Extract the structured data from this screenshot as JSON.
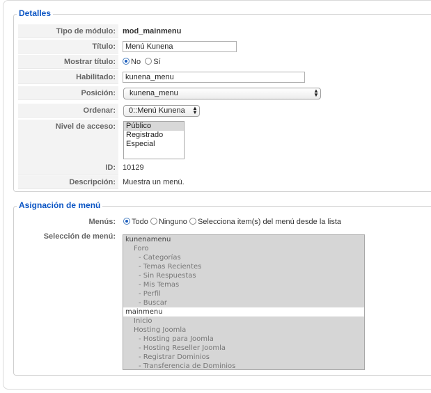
{
  "details": {
    "legend": "Detalles",
    "module_type": {
      "label": "Tipo de módulo:",
      "value": "mod_mainmenu"
    },
    "title": {
      "label": "Título:",
      "value": "Menú Kunena"
    },
    "show_title": {
      "label": "Mostrar título:",
      "options": [
        "No",
        "Sí"
      ],
      "selected": "No"
    },
    "enabled": {
      "label": "Habilitado:",
      "value": "kunena_menu"
    },
    "position": {
      "label": "Posición:",
      "value": "kunena_menu"
    },
    "order": {
      "label": "Ordenar:",
      "value": "0::Menú Kunena"
    },
    "access": {
      "label": "Nivel de acceso:",
      "options": [
        "Público",
        "Registrado",
        "Especial"
      ],
      "selected": "Público"
    },
    "id": {
      "label": "ID:",
      "value": "10129"
    },
    "description": {
      "label": "Descripción:",
      "value": "Muestra un menú."
    }
  },
  "menu_assignment": {
    "legend": "Asignación de menú",
    "menus": {
      "label": "Menús:",
      "options": [
        "Todo",
        "Ninguno",
        "Selecciona item(s) del menú desde la lista"
      ],
      "selected": "Todo"
    },
    "selection": {
      "label": "Selección de menú:",
      "items": [
        {
          "text": "kunenamenu",
          "level": 0
        },
        {
          "text": "Foro",
          "level": 1
        },
        {
          "text": "- Categorías",
          "level": 2
        },
        {
          "text": "- Temas Recientes",
          "level": 2
        },
        {
          "text": "- Sin Respuestas",
          "level": 2
        },
        {
          "text": "- Mis Temas",
          "level": 2
        },
        {
          "text": "- Perfil",
          "level": 2
        },
        {
          "text": "- Buscar",
          "level": 2
        },
        {
          "text": "mainmenu",
          "level": 0
        },
        {
          "text": "Inicio",
          "level": 1
        },
        {
          "text": "Hosting Joomla",
          "level": 1
        },
        {
          "text": "- Hosting para Joomla",
          "level": 2
        },
        {
          "text": "- Hosting Reseller Joomla",
          "level": 2
        },
        {
          "text": "- Registrar Dominios",
          "level": 2
        },
        {
          "text": "- Transferencia de Dominios",
          "level": 2
        }
      ]
    }
  },
  "colors": {
    "accent": "#0b55c4",
    "label_bg": "#f3f3f3",
    "selected_bg": "#d6d6d6"
  }
}
